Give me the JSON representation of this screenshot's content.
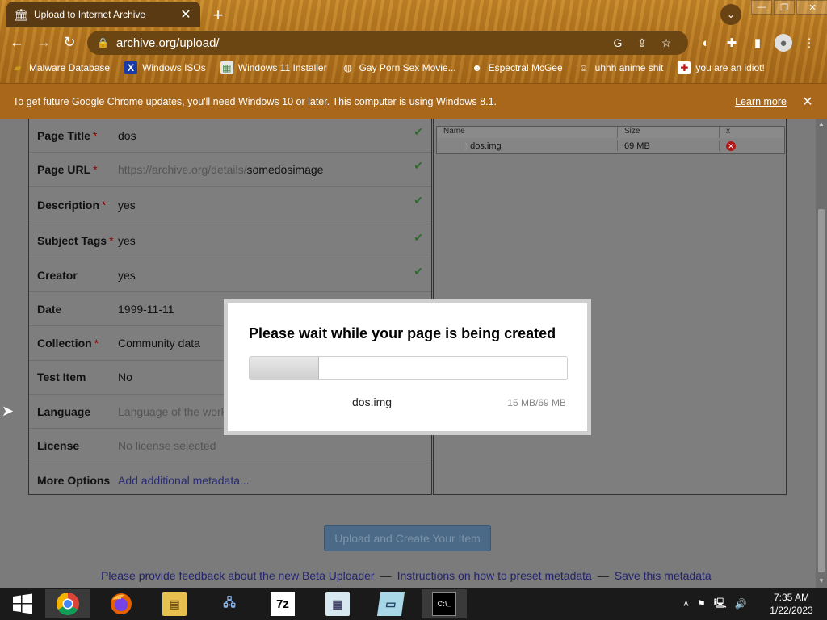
{
  "browser": {
    "tab_title": "Upload to Internet Archive",
    "url": "archive.org/upload/",
    "bookmarks": [
      {
        "label": "Malware Database",
        "icon": "folder-icon"
      },
      {
        "label": "Windows ISOs",
        "icon": "x-logo-icon"
      },
      {
        "label": "Windows 11 Installer",
        "icon": "image-icon"
      },
      {
        "label": "Gay Porn Sex Movie...",
        "icon": "globe-icon"
      },
      {
        "label": "Espectral McGee",
        "icon": "face-icon"
      },
      {
        "label": "uhhh anime shit",
        "icon": "face-icon"
      },
      {
        "label": "you are an idiot!",
        "icon": "flag-icon"
      }
    ]
  },
  "infobar": {
    "message": "To get future Google Chrome updates, you'll need Windows 10 or later. This computer is using Windows 8.1.",
    "learn_more": "Learn more"
  },
  "form": {
    "required_mark": "*",
    "rows": [
      {
        "label": "Page Title",
        "value": "dos"
      },
      {
        "label": "Page URL",
        "value_prefix": "https://archive.org/details/",
        "value": "somedosimage"
      },
      {
        "label": "Description",
        "value": "yes"
      },
      {
        "label": "Subject Tags",
        "value": "yes"
      },
      {
        "label": "Creator",
        "value": "yes"
      },
      {
        "label": "Date",
        "value": "1999-11-11"
      },
      {
        "label": "Collection",
        "value": "Community data"
      },
      {
        "label": "Test Item",
        "value": "No"
      },
      {
        "label": "Language",
        "value": "Language of the work"
      },
      {
        "label": "License",
        "value": "No license selected"
      },
      {
        "label": "More Options",
        "value": "Add additional metadata..."
      }
    ]
  },
  "files": {
    "headers": [
      "Name",
      "Size",
      "x"
    ],
    "rows": [
      {
        "name": "dos.img",
        "size": "69 MB"
      }
    ]
  },
  "submit_label": "Upload and Create Your Item",
  "footer": {
    "link1": "Please provide feedback about the new Beta Uploader",
    "link2": "Instructions on how to preset metadata",
    "link3": "Save this metadata",
    "sep": "—"
  },
  "modal": {
    "title": "Please wait while your page is being created",
    "file_name": "dos.img",
    "progress_text": "15 MB/69 MB",
    "progress_fraction": 0.22
  },
  "taskbar": {
    "time": "7:35 AM",
    "date": "1/22/2023",
    "sevenzip_label": "7z"
  }
}
